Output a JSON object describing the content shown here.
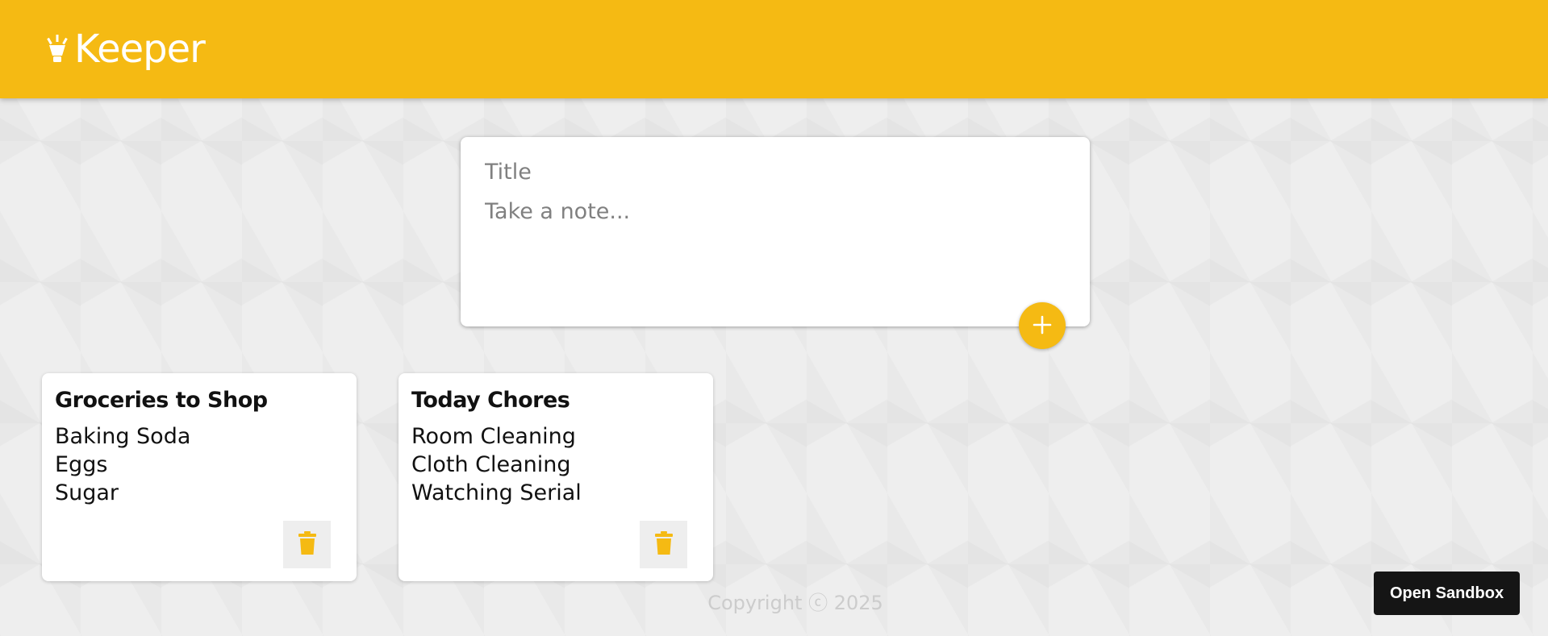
{
  "header": {
    "app_name": "Keeper",
    "logo_icon": "lightbulb-icon"
  },
  "create_note": {
    "title_placeholder": "Title",
    "content_placeholder": "Take a note...",
    "add_button_icon": "plus-icon"
  },
  "notes": [
    {
      "title": "Groceries to Shop",
      "lines": [
        "Baking Soda",
        "Eggs",
        "Sugar"
      ],
      "delete_icon": "trash-icon"
    },
    {
      "title": "Today Chores",
      "lines": [
        "Room Cleaning",
        "Cloth Cleaning",
        "Watching Serial"
      ],
      "delete_icon": "trash-icon"
    }
  ],
  "footer": {
    "copyright": "Copyright ⓒ 2025"
  },
  "sandbox": {
    "label": "Open Sandbox"
  },
  "colors": {
    "accent": "#f5ba13",
    "background": "#eeeeee",
    "card": "#ffffff",
    "sandbox": "#151515"
  }
}
